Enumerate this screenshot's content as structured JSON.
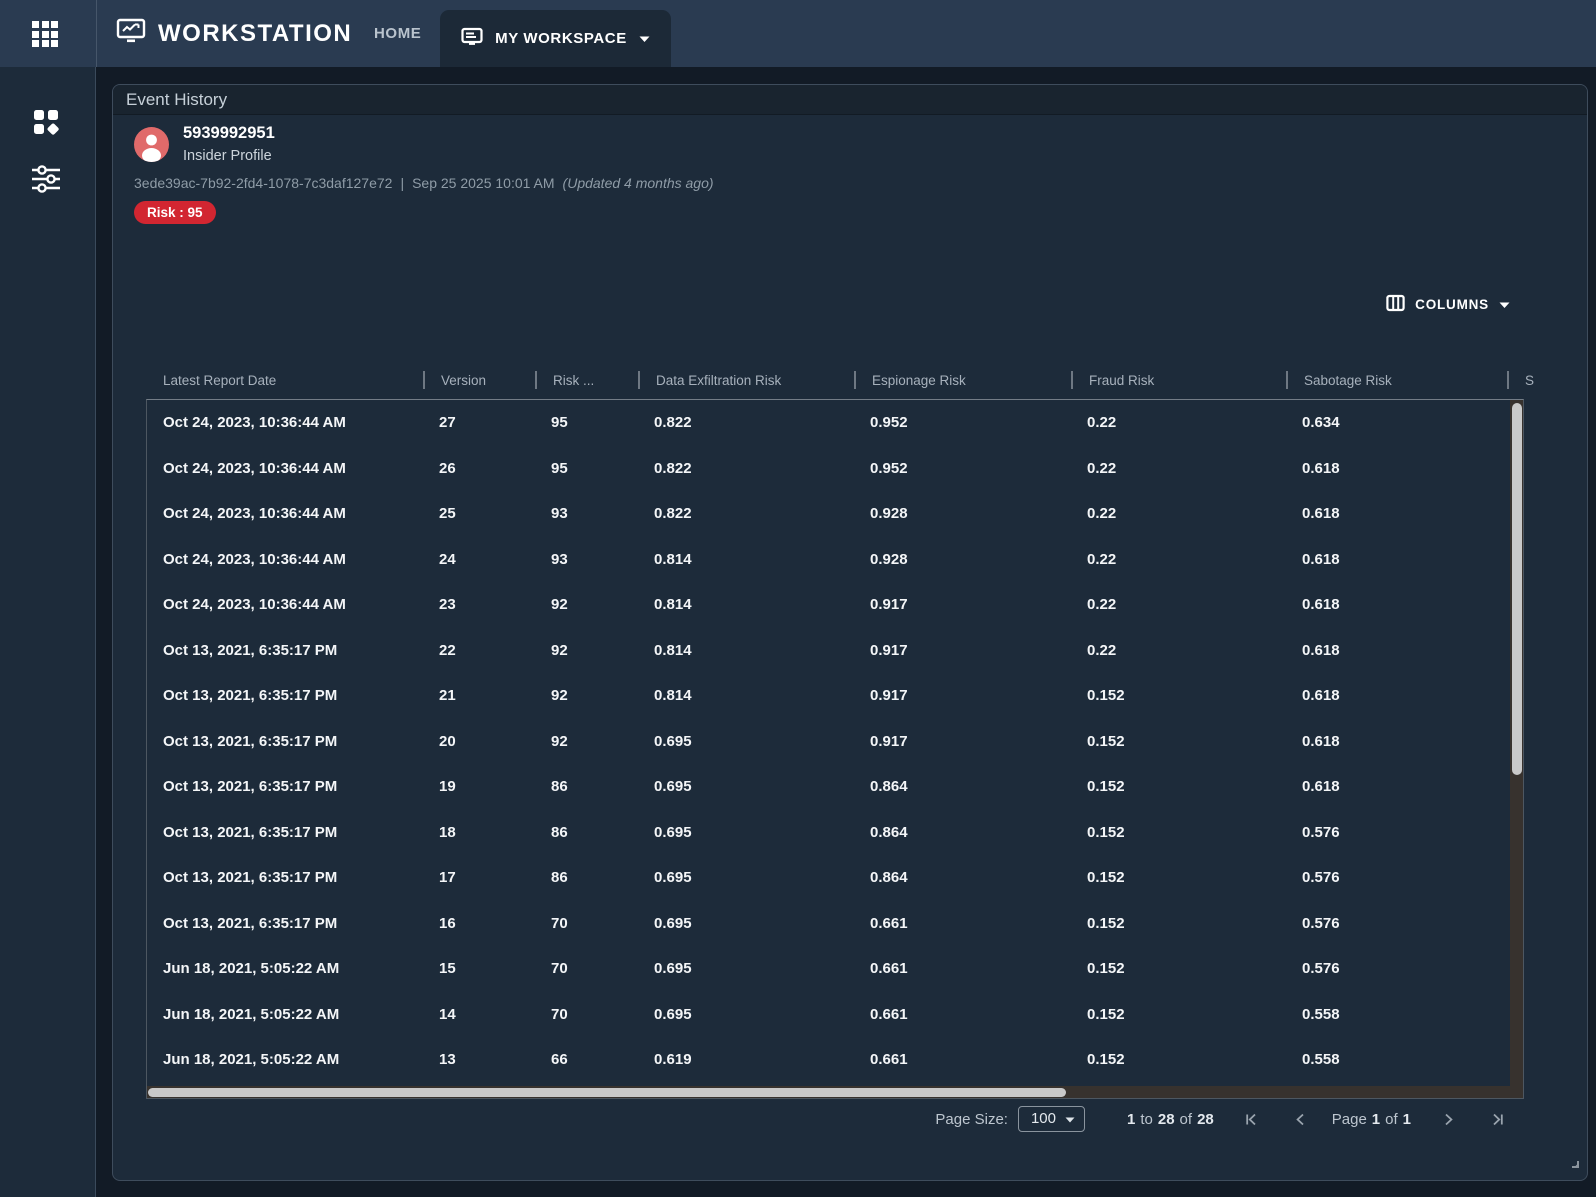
{
  "topbar": {
    "brand": "WORKSTATION",
    "home_label": "HOME",
    "workspace_label": "MY WORKSPACE"
  },
  "panel": {
    "title": "Event History",
    "profile": {
      "name": "5939992951",
      "type": "Insider Profile",
      "uuid": "3ede39ac-7b92-2fd4-1078-7c3daf127e72",
      "meta_separator": "|",
      "timestamp": "Sep 25 2025 10:01 AM",
      "updated_note": "(Updated 4 months ago)",
      "risk_badge": "Risk : 95"
    },
    "columns_button_label": "COLUMNS",
    "table": {
      "headers": [
        "Latest Report Date",
        "Version",
        "Risk ...",
        "Data Exfiltration Risk",
        "Espionage Risk",
        "Fraud Risk",
        "Sabotage Risk",
        "S"
      ],
      "rows": [
        [
          "Oct 24, 2023, 10:36:44 AM",
          "27",
          "95",
          "0.822",
          "0.952",
          "0.22",
          "0.634"
        ],
        [
          "Oct 24, 2023, 10:36:44 AM",
          "26",
          "95",
          "0.822",
          "0.952",
          "0.22",
          "0.618"
        ],
        [
          "Oct 24, 2023, 10:36:44 AM",
          "25",
          "93",
          "0.822",
          "0.928",
          "0.22",
          "0.618"
        ],
        [
          "Oct 24, 2023, 10:36:44 AM",
          "24",
          "93",
          "0.814",
          "0.928",
          "0.22",
          "0.618"
        ],
        [
          "Oct 24, 2023, 10:36:44 AM",
          "23",
          "92",
          "0.814",
          "0.917",
          "0.22",
          "0.618"
        ],
        [
          "Oct 13, 2021, 6:35:17 PM",
          "22",
          "92",
          "0.814",
          "0.917",
          "0.22",
          "0.618"
        ],
        [
          "Oct 13, 2021, 6:35:17 PM",
          "21",
          "92",
          "0.814",
          "0.917",
          "0.152",
          "0.618"
        ],
        [
          "Oct 13, 2021, 6:35:17 PM",
          "20",
          "92",
          "0.695",
          "0.917",
          "0.152",
          "0.618"
        ],
        [
          "Oct 13, 2021, 6:35:17 PM",
          "19",
          "86",
          "0.695",
          "0.864",
          "0.152",
          "0.618"
        ],
        [
          "Oct 13, 2021, 6:35:17 PM",
          "18",
          "86",
          "0.695",
          "0.864",
          "0.152",
          "0.576"
        ],
        [
          "Oct 13, 2021, 6:35:17 PM",
          "17",
          "86",
          "0.695",
          "0.864",
          "0.152",
          "0.576"
        ],
        [
          "Oct 13, 2021, 6:35:17 PM",
          "16",
          "70",
          "0.695",
          "0.661",
          "0.152",
          "0.576"
        ],
        [
          "Jun 18, 2021, 5:05:22 AM",
          "15",
          "70",
          "0.695",
          "0.661",
          "0.152",
          "0.576"
        ],
        [
          "Jun 18, 2021, 5:05:22 AM",
          "14",
          "70",
          "0.695",
          "0.661",
          "0.152",
          "0.558"
        ],
        [
          "Jun 18, 2021, 5:05:22 AM",
          "13",
          "66",
          "0.619",
          "0.661",
          "0.152",
          "0.558"
        ]
      ]
    },
    "pagination": {
      "page_size_label": "Page Size:",
      "page_size_value": "100",
      "range_from": "1",
      "range_to_word": "to",
      "range_end": "28",
      "range_of_word": "of",
      "range_total": "28",
      "page_word": "Page",
      "page_current": "1",
      "page_of_word": "of",
      "page_total": "1"
    }
  },
  "icons": {
    "apps": "apps-grid-icon",
    "brand": "monitor-chart-icon",
    "workspace": "workspace-card-icon",
    "sidebar_top": "widgets-icon",
    "sidebar_bottom": "tune-sliders-icon",
    "avatar": "person-icon",
    "columns": "columns-icon",
    "caret": "chevron-down-icon"
  },
  "colors": {
    "topbar": "#2a3b51",
    "panel": "#1d2b3a",
    "page_background": "#121b26",
    "risk_red": "#d22631",
    "avatar_red": "#e06a6a",
    "scroll_thumb": "#c9c9c9",
    "scroll_track": "#37322e"
  }
}
